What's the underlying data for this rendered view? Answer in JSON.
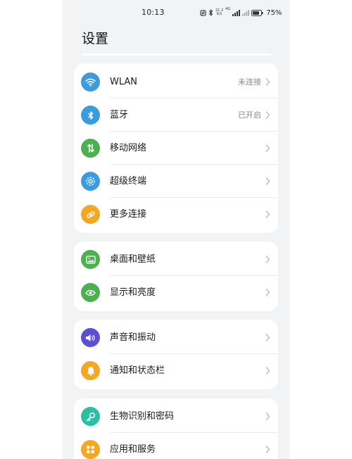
{
  "status_bar": {
    "time": "10:13",
    "network_top": "21.2",
    "network_bottom": "K/s",
    "signal_label": "4G",
    "battery_percent": "75%",
    "icons": [
      "nfc-icon",
      "bluetooth-icon",
      "network-speed",
      "signal-icon",
      "signal-icon-2",
      "battery-icon"
    ]
  },
  "header": {
    "title": "设置"
  },
  "groups": [
    {
      "items": [
        {
          "label": "WLAN",
          "value": "未连接",
          "icon": "wifi-icon",
          "color": "#3a9be0"
        },
        {
          "label": "蓝牙",
          "value": "已开启",
          "icon": "bluetooth-icon",
          "color": "#3a9be0"
        },
        {
          "label": "移动网络",
          "value": "",
          "icon": "mobile-data-icon",
          "color": "#4caf50"
        },
        {
          "label": "超级终端",
          "value": "",
          "icon": "super-device-icon",
          "color": "#3a9be0"
        },
        {
          "label": "更多连接",
          "value": "",
          "icon": "link-icon",
          "color": "#f5a623"
        }
      ]
    },
    {
      "items": [
        {
          "label": "桌面和壁纸",
          "value": "",
          "icon": "wallpaper-icon",
          "color": "#4caf50"
        },
        {
          "label": "显示和亮度",
          "value": "",
          "icon": "eye-icon",
          "color": "#4caf50"
        }
      ]
    },
    {
      "items": [
        {
          "label": "声音和振动",
          "value": "",
          "icon": "speaker-icon",
          "color": "#5b4fd6"
        },
        {
          "label": "通知和状态栏",
          "value": "",
          "icon": "bell-icon",
          "color": "#f5a623"
        }
      ]
    },
    {
      "items": [
        {
          "label": "生物识别和密码",
          "value": "",
          "icon": "key-icon",
          "color": "#2bbfa4"
        },
        {
          "label": "应用和服务",
          "value": "",
          "icon": "apps-icon",
          "color": "#f5a623"
        }
      ]
    }
  ]
}
